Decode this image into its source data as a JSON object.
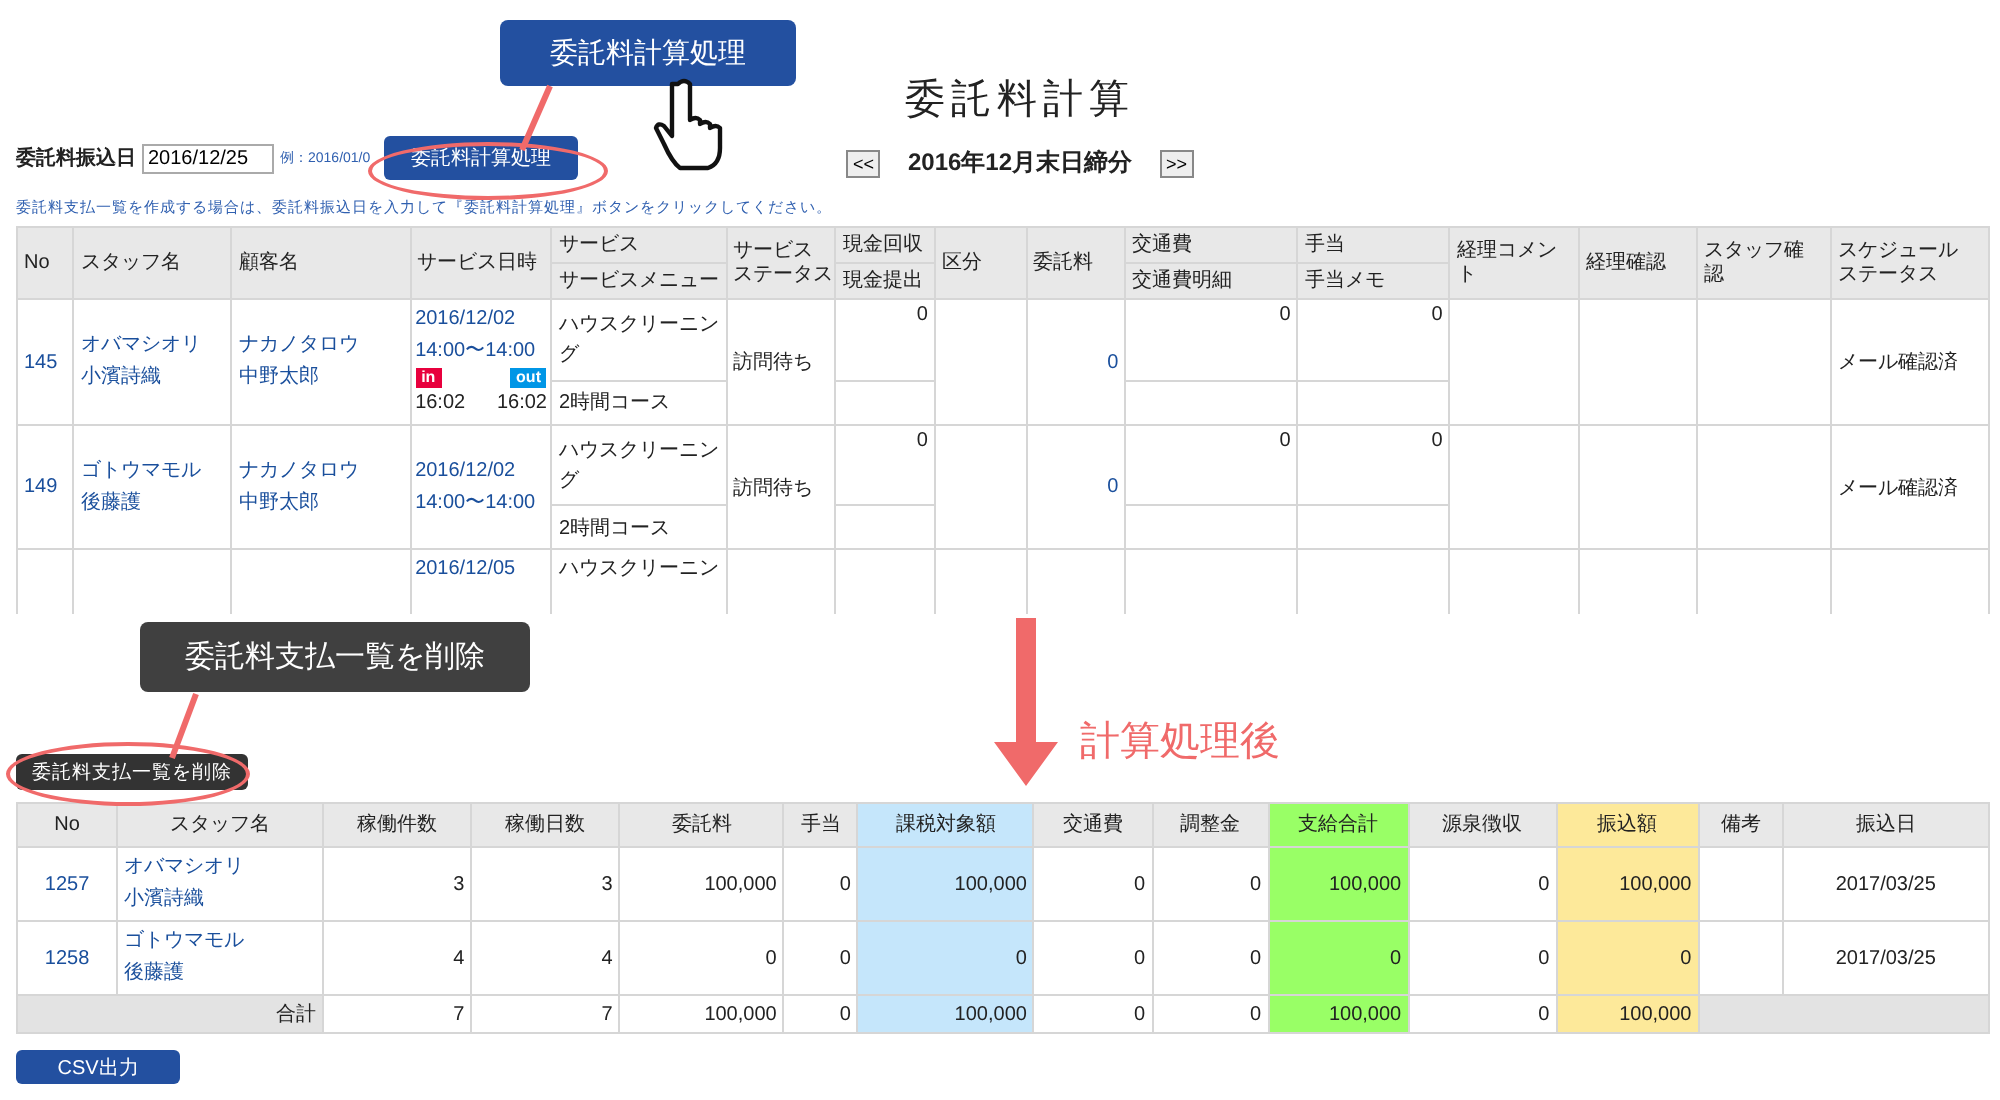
{
  "page_title": "委託料計算",
  "period": {
    "prev": "<<",
    "label": "2016年12月末日締分",
    "next": ">>"
  },
  "transfer_date": {
    "label": "委託料振込日",
    "value": "2016/12/25",
    "hint": "例：2016/01/0"
  },
  "calc_button": "委託料計算処理",
  "calc_callout": "委託料計算処理",
  "note": "委託料支払一覧を作成する場合は、委託料振込日を入力して『委託料計算処理』ボタンをクリックしてください。",
  "schedule_table": {
    "columns": [
      {
        "label": "No"
      },
      {
        "label": "スタッフ名"
      },
      {
        "label": "顧客名"
      },
      {
        "label": "サービス日時"
      },
      {
        "label": "サービス",
        "sub": "サービスメニュー"
      },
      {
        "lines": [
          "サービス",
          "ステータス"
        ]
      },
      {
        "label": "現金回収",
        "sub": "現金提出"
      },
      {
        "label": "区分"
      },
      {
        "label": "委託料"
      },
      {
        "label": "交通費",
        "sub": "交通費明細"
      },
      {
        "label": "手当",
        "sub": "手当メモ"
      },
      {
        "label": "経理コメント"
      },
      {
        "label": "経理確認"
      },
      {
        "label": "スタッフ確認"
      },
      {
        "lines": [
          "スケジュール",
          "ステータス"
        ]
      }
    ],
    "rows": [
      {
        "no": "145",
        "staff_kana": "オバマシオリ",
        "staff_name": "小濱詩織",
        "customer_kana": "ナカノタロウ",
        "customer_name": "中野太郎",
        "date": "2016/12/02",
        "time": "14:00〜14:00",
        "check": {
          "in": "in",
          "out": "out",
          "in_time": "16:02",
          "out_time": "16:02"
        },
        "service": "ハウスクリーニング",
        "menu": "2時間コース",
        "status": "訪問待ち",
        "cash": "0",
        "fee": "0",
        "transport": "0",
        "allowance": "0",
        "schedule_status": "メール確認済"
      },
      {
        "no": "149",
        "staff_kana": "ゴトウマモル",
        "staff_name": "後藤護",
        "customer_kana": "ナカノタロウ",
        "customer_name": "中野太郎",
        "date": "2016/12/02",
        "time": "14:00〜14:00",
        "service": "ハウスクリーニング",
        "menu": "2時間コース",
        "status": "訪問待ち",
        "cash": "0",
        "fee": "0",
        "transport": "0",
        "allowance": "0",
        "schedule_status": "メール確認済"
      },
      {
        "date": "2016/12/05",
        "service": "ハウスクリーニン"
      }
    ]
  },
  "delete_callout": "委託料支払一覧を削除",
  "delete_button": "委託料支払一覧を削除",
  "after_label": "計算処理後",
  "payment_table": {
    "columns": [
      {
        "label": "No"
      },
      {
        "label": "スタッフ名"
      },
      {
        "label": "稼働件数"
      },
      {
        "label": "稼働日数"
      },
      {
        "label": "委託料"
      },
      {
        "label": "手当"
      },
      {
        "label": "課税対象額",
        "color": "#c5e6fb"
      },
      {
        "label": "交通費"
      },
      {
        "label": "調整金"
      },
      {
        "label": "支給合計",
        "color": "#99ff66"
      },
      {
        "label": "源泉徴収"
      },
      {
        "label": "振込額",
        "color": "#fde99a"
      },
      {
        "label": "備考"
      },
      {
        "label": "振込日"
      }
    ],
    "rows": [
      {
        "no": "1257",
        "staff_kana": "オバマシオリ",
        "staff_name": "小濱詩織",
        "values": [
          "3",
          "3",
          "100,000",
          "0",
          "100,000",
          "0",
          "0",
          "100,000",
          "0",
          "100,000"
        ],
        "transfer_date": "2017/03/25"
      },
      {
        "no": "1258",
        "staff_kana": "ゴトウマモル",
        "staff_name": "後藤護",
        "values": [
          "4",
          "4",
          "0",
          "0",
          "0",
          "0",
          "0",
          "0",
          "0",
          "0"
        ],
        "transfer_date": "2017/03/25"
      }
    ],
    "total": {
      "label": "合計",
      "values": [
        "7",
        "7",
        "100,000",
        "0",
        "100,000",
        "0",
        "0",
        "100,000",
        "0",
        "100,000"
      ]
    }
  },
  "csv_button": "CSV出力"
}
